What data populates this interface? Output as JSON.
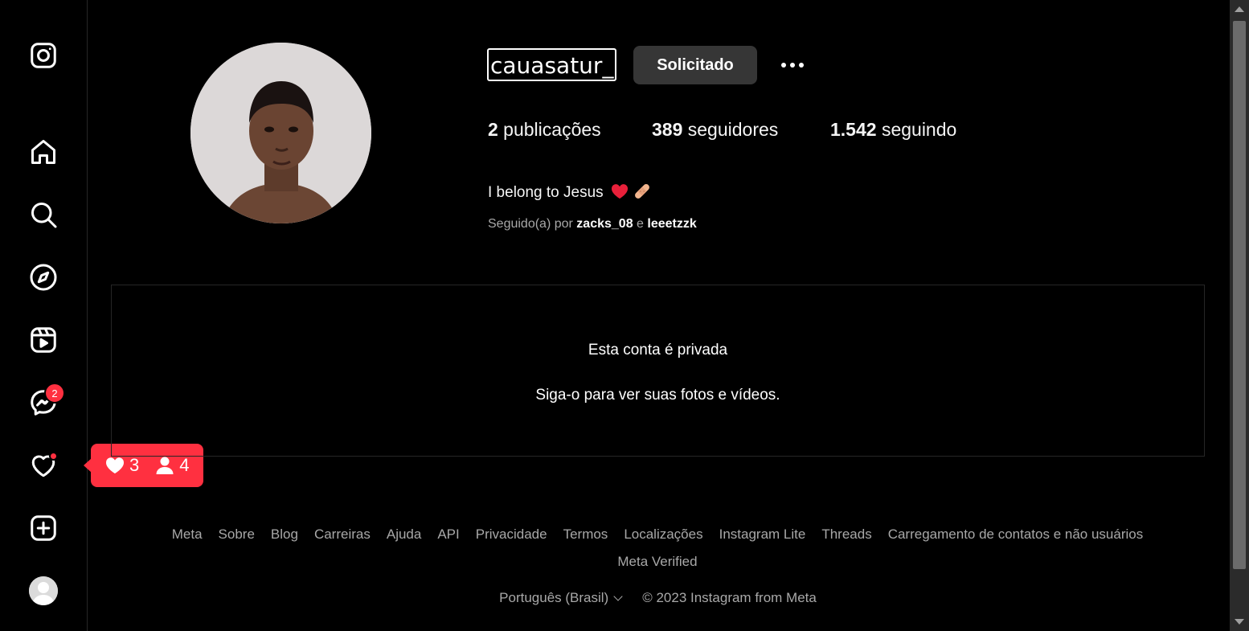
{
  "sidebar": {
    "items": [
      {
        "name": "instagram-logo",
        "icon": "instagram-icon"
      },
      {
        "name": "home",
        "icon": "home-icon"
      },
      {
        "name": "search",
        "icon": "search-icon"
      },
      {
        "name": "explore",
        "icon": "compass-icon"
      },
      {
        "name": "reels",
        "icon": "reels-icon"
      },
      {
        "name": "messages",
        "icon": "messenger-icon",
        "badge": "2"
      },
      {
        "name": "notifications",
        "icon": "heart-icon"
      },
      {
        "name": "create",
        "icon": "plus-square-icon"
      },
      {
        "name": "profile",
        "icon": "avatar-icon"
      }
    ],
    "activity": {
      "likes": "3",
      "follows": "4"
    }
  },
  "profile": {
    "username": "cauasatur_",
    "follow_button": "Solicitado",
    "stats": {
      "posts_count": "2",
      "posts_label": " publicações",
      "followers_count": "389",
      "followers_label": " seguidores",
      "following_count": "1.542",
      "following_label": " seguindo"
    },
    "bio": "I belong to Jesus",
    "bio_emojis": [
      "red-heart",
      "bandage"
    ],
    "followed_by_prefix": "Seguido(a) por ",
    "followed_by_user1": "zacks_08",
    "followed_by_joiner": " e ",
    "followed_by_user2": "leeetzzk"
  },
  "private": {
    "title": "Esta conta é privada",
    "subtitle": "Siga-o para ver suas fotos e vídeos."
  },
  "footer": {
    "links": [
      "Meta",
      "Sobre",
      "Blog",
      "Carreiras",
      "Ajuda",
      "API",
      "Privacidade",
      "Termos",
      "Localizações",
      "Instagram Lite",
      "Threads",
      "Carregamento de contatos e não usuários",
      "Meta Verified"
    ],
    "language": "Português (Brasil)",
    "copyright": "© 2023 Instagram from Meta"
  },
  "colors": {
    "background": "#000000",
    "badge": "#ff3040",
    "button": "#363636",
    "muted_text": "#a8a8a8"
  }
}
